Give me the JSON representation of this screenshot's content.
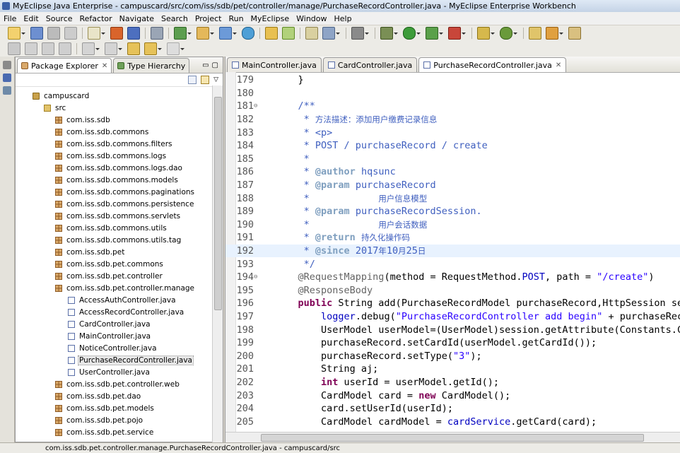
{
  "window": {
    "title": "MyEclipse Java Enterprise - campuscard/src/com/iss/sdb/pet/controller/manage/PurchaseRecordController.java - MyEclipse Enterprise Workbench"
  },
  "menu": [
    "File",
    "Edit",
    "Source",
    "Refactor",
    "Navigate",
    "Search",
    "Project",
    "Run",
    "MyEclipse",
    "Window",
    "Help"
  ],
  "explorer": {
    "tabs": [
      {
        "label": "Package Explorer",
        "active": true
      },
      {
        "label": "Type Hierarchy",
        "active": false
      }
    ],
    "tree": [
      {
        "label": "campuscard",
        "type": "project",
        "indent": 0
      },
      {
        "label": "src",
        "type": "folder",
        "indent": 1
      },
      {
        "label": "com.iss.sdb",
        "type": "package",
        "indent": 2
      },
      {
        "label": "com.iss.sdb.commons",
        "type": "package",
        "indent": 2
      },
      {
        "label": "com.iss.sdb.commons.filters",
        "type": "package",
        "indent": 2
      },
      {
        "label": "com.iss.sdb.commons.logs",
        "type": "package",
        "indent": 2
      },
      {
        "label": "com.iss.sdb.commons.logs.dao",
        "type": "package",
        "indent": 2
      },
      {
        "label": "com.iss.sdb.commons.models",
        "type": "package",
        "indent": 2
      },
      {
        "label": "com.iss.sdb.commons.paginations",
        "type": "package",
        "indent": 2
      },
      {
        "label": "com.iss.sdb.commons.persistence",
        "type": "package",
        "indent": 2
      },
      {
        "label": "com.iss.sdb.commons.servlets",
        "type": "package",
        "indent": 2
      },
      {
        "label": "com.iss.sdb.commons.utils",
        "type": "package",
        "indent": 2
      },
      {
        "label": "com.iss.sdb.commons.utils.tag",
        "type": "package",
        "indent": 2
      },
      {
        "label": "com.iss.sdb.pet",
        "type": "package",
        "indent": 2
      },
      {
        "label": "com.iss.sdb.pet.commons",
        "type": "package",
        "indent": 2
      },
      {
        "label": "com.iss.sdb.pet.controller",
        "type": "package",
        "indent": 2
      },
      {
        "label": "com.iss.sdb.pet.controller.manage",
        "type": "package",
        "indent": 2
      },
      {
        "label": "AccessAuthController.java",
        "type": "java",
        "indent": 3
      },
      {
        "label": "AccessRecordController.java",
        "type": "java",
        "indent": 3
      },
      {
        "label": "CardController.java",
        "type": "java",
        "indent": 3
      },
      {
        "label": "MainController.java",
        "type": "java",
        "indent": 3
      },
      {
        "label": "NoticeController.java",
        "type": "java",
        "indent": 3
      },
      {
        "label": "PurchaseRecordController.java",
        "type": "java",
        "indent": 3,
        "selected": true
      },
      {
        "label": "UserController.java",
        "type": "java",
        "indent": 3
      },
      {
        "label": "com.iss.sdb.pet.controller.web",
        "type": "package",
        "indent": 2
      },
      {
        "label": "com.iss.sdb.pet.dao",
        "type": "package",
        "indent": 2
      },
      {
        "label": "com.iss.sdb.pet.models",
        "type": "package",
        "indent": 2
      },
      {
        "label": "com.iss.sdb.pet.pojo",
        "type": "package",
        "indent": 2
      },
      {
        "label": "com.iss.sdb.pet.service",
        "type": "package",
        "indent": 2
      }
    ]
  },
  "editor": {
    "tabs": [
      {
        "label": "MainController.java",
        "active": false
      },
      {
        "label": "CardController.java",
        "active": false
      },
      {
        "label": "PurchaseRecordController.java",
        "active": true
      }
    ],
    "lines": [
      {
        "n": "179",
        "fold": "",
        "hl": false,
        "tokens": [
          [
            "p",
            "    }"
          ]
        ]
      },
      {
        "n": "180",
        "fold": "",
        "hl": false,
        "tokens": []
      },
      {
        "n": "181",
        "fold": "⊖",
        "hl": false,
        "tokens": [
          [
            "c",
            "    /**"
          ]
        ]
      },
      {
        "n": "182",
        "fold": "",
        "hl": false,
        "tokens": [
          [
            "c",
            "     * "
          ],
          [
            "cn",
            "方法描述：添加用户缴费记录信息"
          ]
        ]
      },
      {
        "n": "183",
        "fold": "",
        "hl": false,
        "tokens": [
          [
            "c",
            "     * <p>"
          ]
        ]
      },
      {
        "n": "184",
        "fold": "",
        "hl": false,
        "tokens": [
          [
            "c",
            "     * POST / purchaseRecord / create"
          ]
        ]
      },
      {
        "n": "185",
        "fold": "",
        "hl": false,
        "tokens": [
          [
            "c",
            "     *"
          ]
        ]
      },
      {
        "n": "186",
        "fold": "",
        "hl": false,
        "tokens": [
          [
            "c",
            "     * "
          ],
          [
            "t",
            "@author"
          ],
          [
            "c",
            " hqsunc"
          ]
        ]
      },
      {
        "n": "187",
        "fold": "",
        "hl": false,
        "tokens": [
          [
            "c",
            "     * "
          ],
          [
            "t",
            "@param"
          ],
          [
            "c",
            " purchaseRecord"
          ]
        ]
      },
      {
        "n": "188",
        "fold": "",
        "hl": false,
        "tokens": [
          [
            "c",
            "     *            "
          ],
          [
            "cn",
            "用户信息模型"
          ]
        ]
      },
      {
        "n": "189",
        "fold": "",
        "hl": false,
        "tokens": [
          [
            "c",
            "     * "
          ],
          [
            "t",
            "@param"
          ],
          [
            "c",
            " purchaseRecordSession."
          ]
        ]
      },
      {
        "n": "190",
        "fold": "",
        "hl": false,
        "tokens": [
          [
            "c",
            "     *            "
          ],
          [
            "cn",
            "用户会话数据"
          ]
        ]
      },
      {
        "n": "191",
        "fold": "",
        "hl": false,
        "tokens": [
          [
            "c",
            "     * "
          ],
          [
            "t",
            "@return"
          ],
          [
            "c",
            " "
          ],
          [
            "cn",
            "持久化操作码"
          ]
        ]
      },
      {
        "n": "192",
        "fold": "",
        "hl": true,
        "tokens": [
          [
            "c",
            "     * "
          ],
          [
            "t",
            "@since"
          ],
          [
            "c",
            " 2017"
          ],
          [
            "cn",
            "年"
          ],
          [
            "c",
            "10"
          ],
          [
            "cn",
            "月"
          ],
          [
            "c",
            "25"
          ],
          [
            "cn",
            "日"
          ]
        ]
      },
      {
        "n": "193",
        "fold": "",
        "hl": false,
        "tokens": [
          [
            "c",
            "     */"
          ]
        ]
      },
      {
        "n": "194",
        "fold": "⊖",
        "hl": false,
        "tokens": [
          [
            "a",
            "    @RequestMapping"
          ],
          [
            "p",
            "(method = RequestMethod."
          ],
          [
            "f",
            "POST"
          ],
          [
            "p",
            ", path = "
          ],
          [
            "s",
            "\"/create\""
          ],
          [
            "p",
            ")"
          ]
        ]
      },
      {
        "n": "195",
        "fold": "",
        "hl": false,
        "tokens": [
          [
            "a",
            "    @ResponseBody"
          ]
        ]
      },
      {
        "n": "196",
        "fold": "",
        "hl": false,
        "tokens": [
          [
            "k",
            "    public"
          ],
          [
            "p",
            " String add(PurchaseRecordModel purchaseRecord,HttpSession se"
          ]
        ]
      },
      {
        "n": "197",
        "fold": "",
        "hl": false,
        "tokens": [
          [
            "p",
            "        "
          ],
          [
            "f",
            "logger"
          ],
          [
            "p",
            ".debug("
          ],
          [
            "s",
            "\"PurchaseRecordController add begin\""
          ],
          [
            "p",
            " + purchaseRec"
          ]
        ]
      },
      {
        "n": "198",
        "fold": "",
        "hl": false,
        "tokens": [
          [
            "p",
            "        UserModel userModel=(UserModel)session.getAttribute(Constants.C"
          ]
        ]
      },
      {
        "n": "199",
        "fold": "",
        "hl": false,
        "tokens": [
          [
            "p",
            "        purchaseRecord.setCardId(userModel.getCardId());"
          ]
        ]
      },
      {
        "n": "200",
        "fold": "",
        "hl": false,
        "tokens": [
          [
            "p",
            "        purchaseRecord.setType("
          ],
          [
            "s",
            "\"3\""
          ],
          [
            "p",
            ");"
          ]
        ]
      },
      {
        "n": "201",
        "fold": "",
        "hl": false,
        "tokens": [
          [
            "p",
            "        String aj;"
          ]
        ]
      },
      {
        "n": "202",
        "fold": "",
        "hl": false,
        "tokens": [
          [
            "k",
            "        int"
          ],
          [
            "p",
            " userId = userModel.getId();"
          ]
        ]
      },
      {
        "n": "203",
        "fold": "",
        "hl": false,
        "tokens": [
          [
            "p",
            "        CardModel card = "
          ],
          [
            "k",
            "new"
          ],
          [
            "p",
            " CardModel();"
          ]
        ]
      },
      {
        "n": "204",
        "fold": "",
        "hl": false,
        "tokens": [
          [
            "p",
            "        card.setUserId(userId);"
          ]
        ]
      },
      {
        "n": "205",
        "fold": "",
        "hl": false,
        "tokens": [
          [
            "p",
            "        CardModel cardModel = "
          ],
          [
            "f",
            "cardService"
          ],
          [
            "p",
            ".getCard(card);"
          ]
        ]
      }
    ]
  },
  "status": {
    "text": "com.iss.sdb.pet.controller.manage.PurchaseRecordController.java - campuscard/src"
  },
  "colors": {
    "comment": "#3f5fbf",
    "keyword": "#7f0055",
    "string": "#2a00ff",
    "field": "#0000c0",
    "annotation": "#646464",
    "highlight_line": "#e8f2fe"
  },
  "icons": [
    "new-wizard-icon",
    "save-icon",
    "print-icon",
    "run-icon",
    "debug-icon",
    "search-icon",
    "package-icon",
    "java-file-icon",
    "folder-icon",
    "project-icon"
  ]
}
